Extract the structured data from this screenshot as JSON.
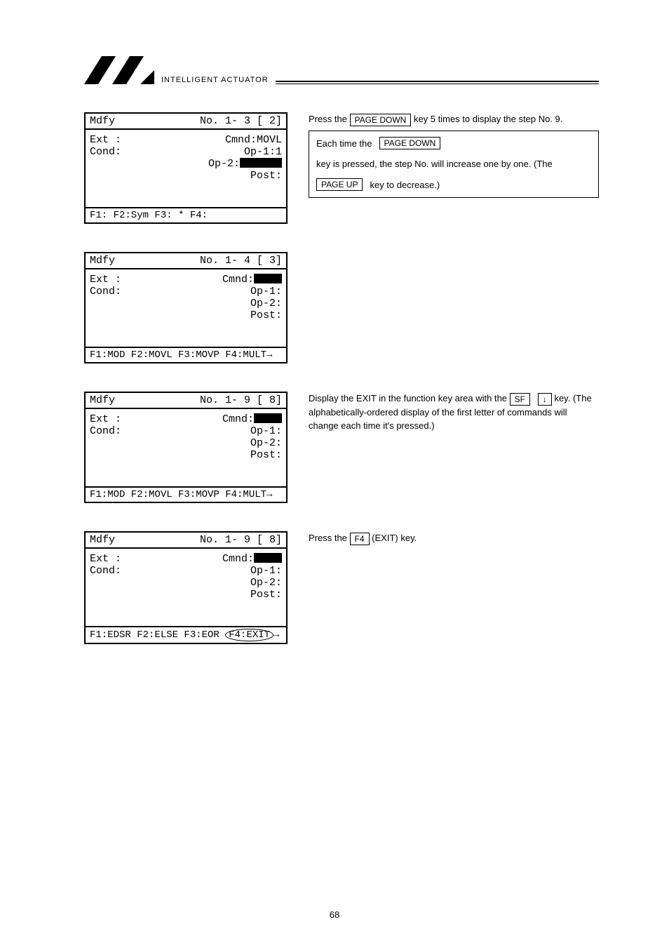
{
  "header": {
    "brand": "INTELLIGENT ACTUATOR"
  },
  "block1": {
    "top_left": "Mdfy",
    "top_right": "No.  1-  3   [   2]",
    "ext": "Ext :",
    "cond": "Cond:",
    "cmnd_lbl": "Cmnd:",
    "cmnd_val": "MOVL",
    "op1_lbl": "Op-1:",
    "op1_val": " 1",
    "op2_lbl": "Op-2:",
    "post_lbl": "Post:",
    "bottom": "F1:     F2:Sym  F3: *    F4:",
    "side_top_pre": "Press the ",
    "side_top_key": "PAGE DOWN",
    "side_top_post": " key 5 times to display the step No. 9.",
    "side_box_a": "Each time the ",
    "side_box_key1": "PAGE DOWN",
    "side_box_b": " key is pressed, the step No. will increase one by one. (The ",
    "side_box_key2": "PAGE UP",
    "side_box_c": " key to decrease.)"
  },
  "block2": {
    "top_left": "Mdfy",
    "top_right": "No.  1-  4   [   3]",
    "ext": "Ext :",
    "cond": "Cond:",
    "cmnd_lbl": "Cmnd:",
    "op1_lbl": "Op-1:",
    "op2_lbl": "Op-2:",
    "post_lbl": "Post:",
    "bottom": "F1:MOD  F2:MOVL F3:MOVP F4:MULT→"
  },
  "block3": {
    "top_left": "Mdfy",
    "top_right": "No.  1-  9   [   8]",
    "ext": "Ext :",
    "cond": "Cond:",
    "cmnd_lbl": "Cmnd:",
    "op1_lbl": "Op-1:",
    "op2_lbl": "Op-2:",
    "post_lbl": "Post:",
    "bottom": "F1:MOD  F2:MOVL F3:MOVP F4:MULT→",
    "side_a": "Display the EXIT in the function key area with the ",
    "side_key1": "SF",
    "side_key2": "↓",
    "side_b": " key.   (The alphabetically-ordered display of the first letter of commands will change each time it's pressed.)"
  },
  "block4": {
    "top_left": "Mdfy",
    "top_right": "No.  1-  9   [   8]",
    "ext": "Ext :",
    "cond": "Cond:",
    "cmnd_lbl": "Cmnd:",
    "op1_lbl": "Op-1:",
    "op2_lbl": "Op-2:",
    "post_lbl": "Post:",
    "bottom_pre": "F1:EDSR F2:ELSE F3:EOR  ",
    "bottom_oval": "F4:EXIT",
    "bottom_post": "→",
    "side_a": "Press the ",
    "side_key": "F4",
    "side_b": " (EXIT) key."
  },
  "page_number": "68"
}
